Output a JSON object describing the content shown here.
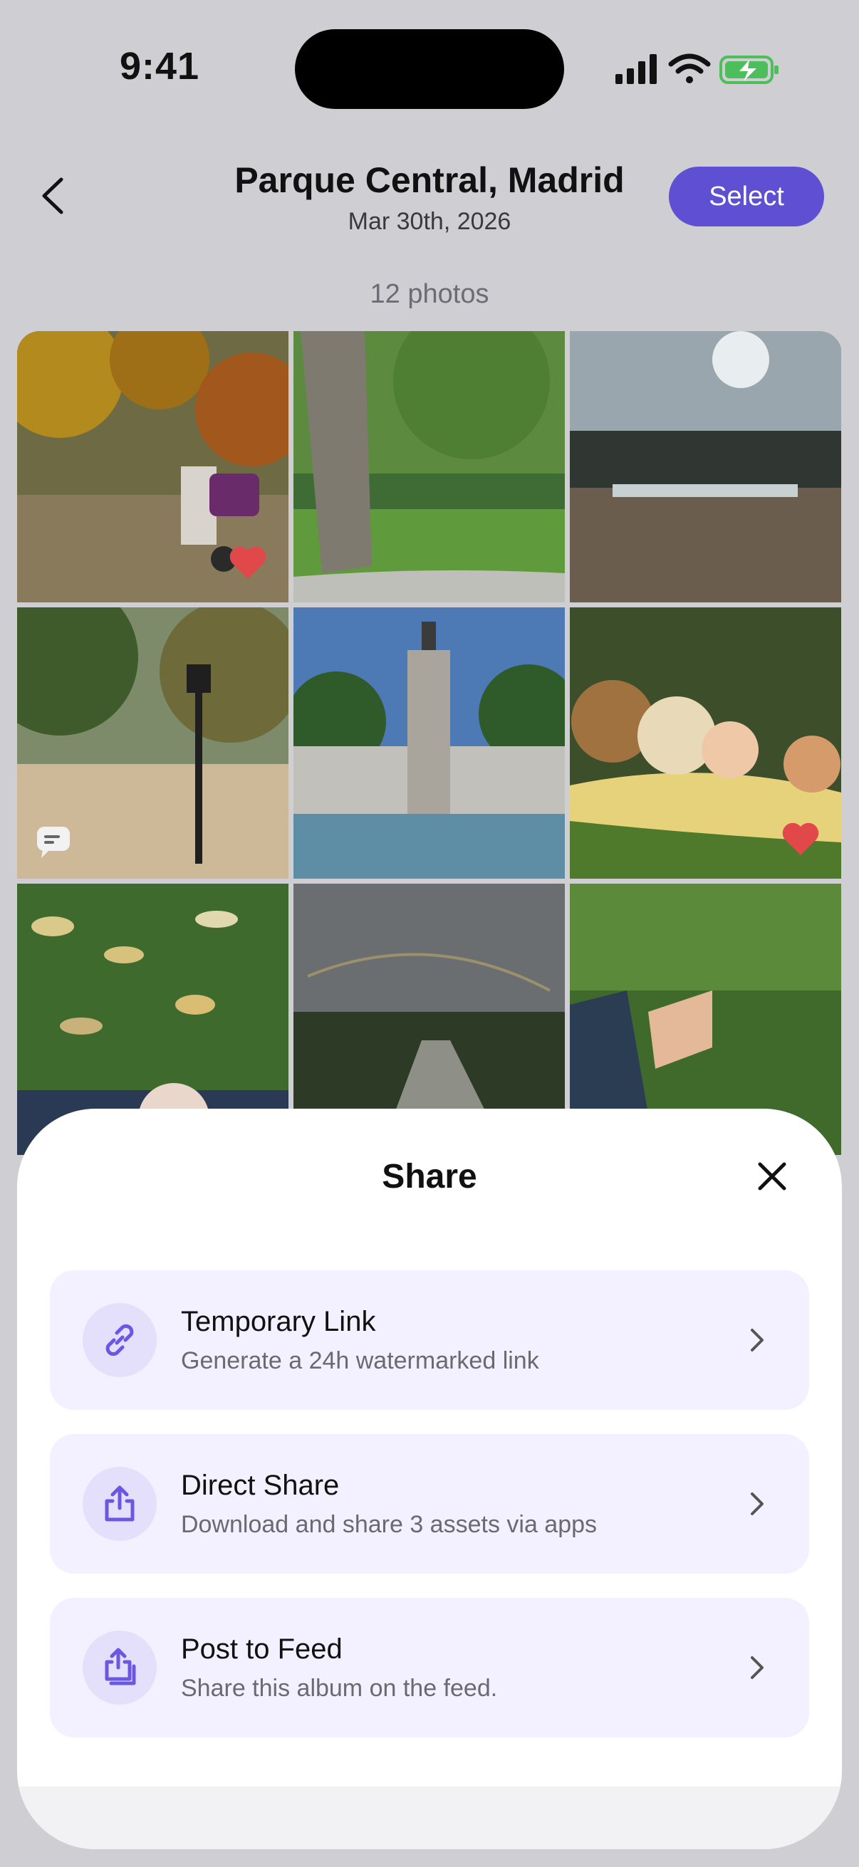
{
  "status": {
    "time": "9:41"
  },
  "nav": {
    "title": "Parque Central, Madrid",
    "date": "Mar 30th, 2026",
    "select_label": "Select"
  },
  "album": {
    "photo_count": "12 photos"
  },
  "photos": [
    {
      "subject": "autumn park, woman with stroller",
      "favorite": true
    },
    {
      "subject": "tree trunk and green lawn"
    },
    {
      "subject": "sunny sky over pond silhouette"
    },
    {
      "subject": "lamp post in autumn park",
      "comment": true
    },
    {
      "subject": "monument with colonnade and lake"
    },
    {
      "subject": "baby with teddy bears on blanket",
      "favorite": true
    },
    {
      "subject": "leaves on grass with baby"
    },
    {
      "subject": "rainbow over garden"
    },
    {
      "subject": "baby feet on grass"
    }
  ],
  "share_sheet": {
    "title": "Share",
    "options": [
      {
        "title": "Temporary Link",
        "description": "Generate a 24h watermarked link",
        "icon": "link-icon"
      },
      {
        "title": "Direct Share",
        "description": "Download and share 3 assets via apps",
        "icon": "share-icon"
      },
      {
        "title": "Post to Feed",
        "description": "Share this album on the feed.",
        "icon": "feed-share-icon"
      }
    ]
  },
  "colors": {
    "accent": "#5f4fd3",
    "option_bg": "#f3f0ff",
    "favorite": "#e0484a"
  }
}
